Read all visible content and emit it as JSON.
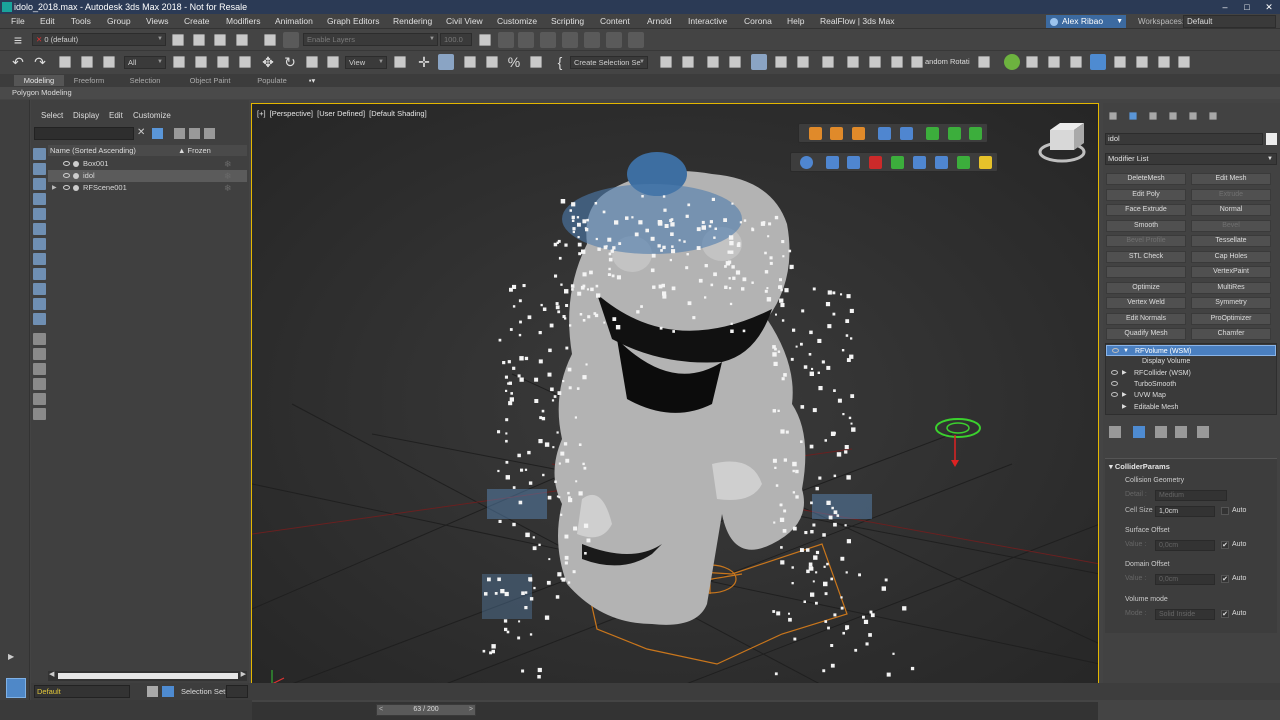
{
  "window": {
    "title": "idolo_2018.max - Autodesk 3ds Max 2018 - Not for Resale"
  },
  "menu": [
    "File",
    "Edit",
    "Tools",
    "Group",
    "Views",
    "Create",
    "Modifiers",
    "Animation",
    "Graph Editors",
    "Rendering",
    "Civil View",
    "Customize",
    "Scripting",
    "Content",
    "Arnold",
    "Interactive",
    "Corona",
    "Help",
    "RealFlow | 3ds Max"
  ],
  "account": {
    "user": "Alex Ribao",
    "workspaces_label": "Workspaces:",
    "workspace": "Default"
  },
  "toolbar": {
    "layer_combo": "0 (default)",
    "enable_layers": "Enable Layers",
    "value_combo": "100.0",
    "filter_combo": "All",
    "view_combo": "View",
    "selection_set": "Create Selection Se",
    "random_rotate": "andom Rotati"
  },
  "ribbon": {
    "tabs": [
      "Modeling",
      "Freeform",
      "Selection",
      "Object Paint",
      "Populate"
    ],
    "active": "Modeling",
    "panel": "Polygon Modeling"
  },
  "explorer": {
    "menu": [
      "Select",
      "Display",
      "Edit",
      "Customize"
    ],
    "col_name": "Name (Sorted Ascending)",
    "col_frozen": "▲ Frozen",
    "rows": [
      {
        "name": "Box001",
        "selected": false,
        "expand": ""
      },
      {
        "name": "idol",
        "selected": true,
        "expand": ""
      },
      {
        "name": "RFScene001",
        "selected": false,
        "expand": "▶"
      }
    ]
  },
  "viewport": {
    "label_plus": "[+]",
    "label_view": "[Perspective]",
    "label_user": "[User Defined]",
    "label_shading": "[Default Shading]"
  },
  "command_panel": {
    "object_name": "idol",
    "modifier_list": "Modifier List",
    "buttons": [
      {
        "label": "DeleteMesh",
        "enabled": true
      },
      {
        "label": "Edit Mesh",
        "enabled": true
      },
      {
        "label": "Edit Poly",
        "enabled": true
      },
      {
        "label": "Extrude",
        "enabled": false
      },
      {
        "label": "Face Extrude",
        "enabled": true
      },
      {
        "label": "Normal",
        "enabled": true
      },
      {
        "label": "Smooth",
        "enabled": true
      },
      {
        "label": "Bevel",
        "enabled": false
      },
      {
        "label": "Bevel Profile",
        "enabled": false
      },
      {
        "label": "Tessellate",
        "enabled": true
      },
      {
        "label": "STL Check",
        "enabled": true
      },
      {
        "label": "Cap Holes",
        "enabled": true
      },
      {
        "label": "",
        "enabled": true
      },
      {
        "label": "VertexPaint",
        "enabled": true
      },
      {
        "label": "Optimize",
        "enabled": true
      },
      {
        "label": "MultiRes",
        "enabled": true
      },
      {
        "label": "Vertex Weld",
        "enabled": true
      },
      {
        "label": "Symmetry",
        "enabled": true
      },
      {
        "label": "Edit Normals",
        "enabled": true
      },
      {
        "label": "ProOptimizer",
        "enabled": true
      },
      {
        "label": "Quadify Mesh",
        "enabled": true
      },
      {
        "label": "Chamfer",
        "enabled": true
      }
    ],
    "stack": [
      {
        "label": "RFVolume (WSM)",
        "selected": true,
        "sub": false,
        "expand": "▼"
      },
      {
        "label": "Display Volume",
        "selected": false,
        "sub": true,
        "expand": ""
      },
      {
        "label": "RFCollider (WSM)",
        "selected": false,
        "sub": false,
        "expand": "▶"
      },
      {
        "label": "TurboSmooth",
        "selected": false,
        "sub": false,
        "expand": ""
      },
      {
        "label": "UVW Map",
        "selected": false,
        "sub": false,
        "expand": "▶"
      },
      {
        "label": "Editable Mesh",
        "selected": false,
        "sub": false,
        "expand": "▶"
      }
    ],
    "rollout": {
      "title": "ColliderParams",
      "collision_geometry": "Collision Geometry",
      "detail_label": "Detail :",
      "detail_value": "Medium",
      "cell_size_label": "Cell Size :",
      "cell_size_value": "1,0cm",
      "surface_offset": "Surface Offset",
      "value_label": "Value :",
      "surface_value": "0,0cm",
      "domain_offset": "Domain Offset",
      "domain_value": "0,0cm",
      "volume_mode": "Volume mode",
      "mode_label": "Mode :",
      "mode_value": "Solid Inside",
      "auto": "Auto",
      "check": "✔"
    }
  },
  "status": {
    "layer": "Default",
    "selection_set": "Selection Set:",
    "frame": "63 / 200"
  }
}
